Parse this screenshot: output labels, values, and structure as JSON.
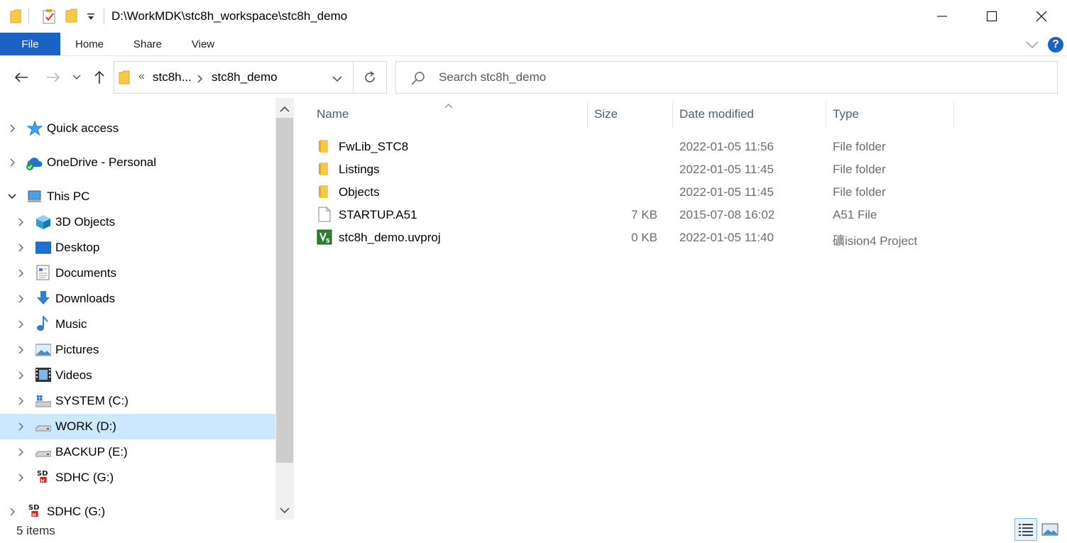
{
  "window": {
    "title": "D:\\WorkMDK\\stc8h_workspace\\stc8h_demo"
  },
  "ribbon": {
    "tabs": [
      "File",
      "Home",
      "Share",
      "View"
    ],
    "help_label": "?"
  },
  "address": {
    "overflow": "«",
    "crumbs": [
      "stc8h...",
      "stc8h_demo"
    ]
  },
  "search": {
    "placeholder": "Search stc8h_demo"
  },
  "nav_pane": {
    "items": [
      {
        "label": "Quick access",
        "icon": "star-icon"
      },
      {
        "label": "OneDrive - Personal",
        "icon": "cloud-icon"
      },
      {
        "label": "This PC",
        "icon": "computer-icon"
      },
      {
        "label": "3D Objects",
        "icon": "cube-icon"
      },
      {
        "label": "Desktop",
        "icon": "desktop-icon"
      },
      {
        "label": "Documents",
        "icon": "document-icon"
      },
      {
        "label": "Downloads",
        "icon": "download-arrow-icon"
      },
      {
        "label": "Music",
        "icon": "music-note-icon"
      },
      {
        "label": "Pictures",
        "icon": "picture-icon"
      },
      {
        "label": "Videos",
        "icon": "film-icon"
      },
      {
        "label": "SYSTEM (C:)",
        "icon": "system-drive-icon"
      },
      {
        "label": "WORK (D:)",
        "icon": "drive-icon"
      },
      {
        "label": "BACKUP (E:)",
        "icon": "drive-icon"
      },
      {
        "label": "SDHC (G:)",
        "icon": "sd-card-icon"
      },
      {
        "label": "SDHC (G:)",
        "icon": "sd-card-icon"
      }
    ],
    "selected": "WORK (D:)"
  },
  "columns": {
    "name": "Name",
    "size": "Size",
    "date": "Date modified",
    "type": "Type"
  },
  "files": [
    {
      "name": "FwLib_STC8",
      "size": "",
      "date": "2022-01-05 11:56",
      "type": "File folder",
      "icon": "folder-icon"
    },
    {
      "name": "Listings",
      "size": "",
      "date": "2022-01-05 11:45",
      "type": "File folder",
      "icon": "folder-icon"
    },
    {
      "name": "Objects",
      "size": "",
      "date": "2022-01-05 11:45",
      "type": "File folder",
      "icon": "folder-icon"
    },
    {
      "name": "STARTUP.A51",
      "size": "7 KB",
      "date": "2015-07-08 16:02",
      "type": "A51 File",
      "icon": "file-icon"
    },
    {
      "name": "stc8h_demo.uvproj",
      "size": "0 KB",
      "date": "2022-01-05 11:40",
      "type": "礦ision4 Project",
      "icon": "uvision-project-icon"
    }
  ],
  "status": {
    "item_count": "5 items"
  },
  "colors": {
    "accent": "#1a63c5",
    "selection": "#cce8ff",
    "folder": "#f8c846"
  }
}
